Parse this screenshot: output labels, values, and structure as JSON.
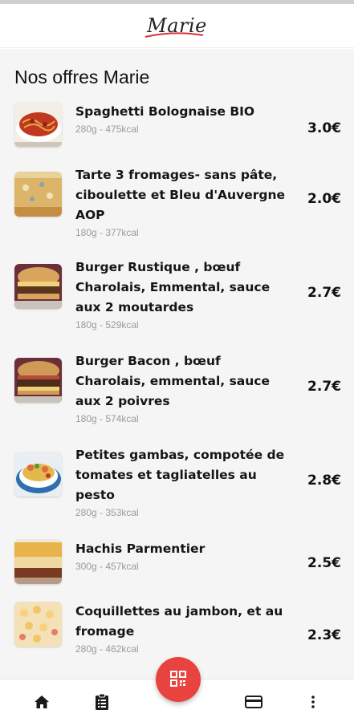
{
  "app": {
    "logo_text": "Marie"
  },
  "main": {
    "section_title": "Nos offres Marie",
    "products": [
      {
        "name": "Spaghetti Bolognaise BIO",
        "meta": "280g - 475kcal",
        "price": "3.0€"
      },
      {
        "name": "Tarte 3 fromages- sans pâte, ciboulette et Bleu d'Auvergne AOP",
        "meta": "180g - 377kcal",
        "price": "2.0€"
      },
      {
        "name": "Burger Rustique , bœuf Charolais, Emmental, sauce aux 2 moutardes",
        "meta": "180g - 529kcal",
        "price": "2.7€"
      },
      {
        "name": "Burger Bacon , bœuf Charolais, emmental, sauce aux 2 poivres",
        "meta": "180g - 574kcal",
        "price": "2.7€"
      },
      {
        "name": "Petites gambas, compotée de tomates et tagliatelles au pesto",
        "meta": "280g - 353kcal",
        "price": "2.8€"
      },
      {
        "name": "Hachis Parmentier",
        "meta": "300g - 457kcal",
        "price": "2.5€"
      },
      {
        "name": "Coquillettes au jambon, et au fromage",
        "meta": "280g - 462kcal",
        "price": "2.3€"
      }
    ]
  },
  "fab": {
    "icon": "qr-code-icon"
  },
  "bottom_nav": {
    "icons": [
      "home-icon",
      "clipboard-list-icon",
      "credit-card-icon",
      "more-vertical-icon"
    ]
  },
  "colors": {
    "accent": "#e8433f",
    "background": "#f5f5f5",
    "meta_text": "#9a9a9a"
  }
}
